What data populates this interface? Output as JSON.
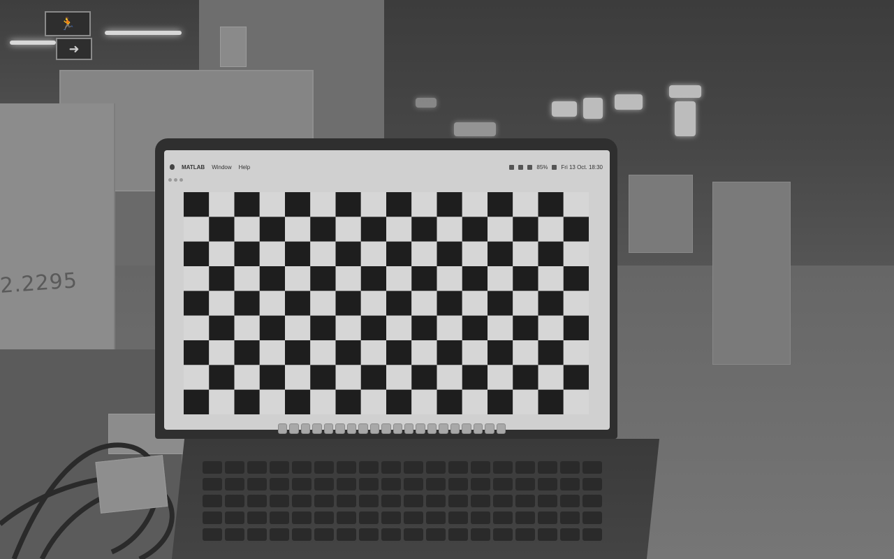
{
  "scene": {
    "description_colors": {
      "background": "#6a6a6a",
      "screen": "#d0d0d0",
      "checker_dark": "#1e1e1e",
      "checker_light": "#d6d6d6"
    },
    "whiteboard_text": "2.2295",
    "exit_sign_icon": "exit-running-man-icon"
  },
  "laptop": {
    "menubar": {
      "app_name": "MATLAB",
      "menus": [
        "Window",
        "Help"
      ],
      "status_battery": "85%",
      "clock": "Fri 13 Oct. 18:30"
    },
    "checkerboard": {
      "columns": 16,
      "rows": 9,
      "top_left_dark": true
    },
    "dock_icon_count": 20
  }
}
